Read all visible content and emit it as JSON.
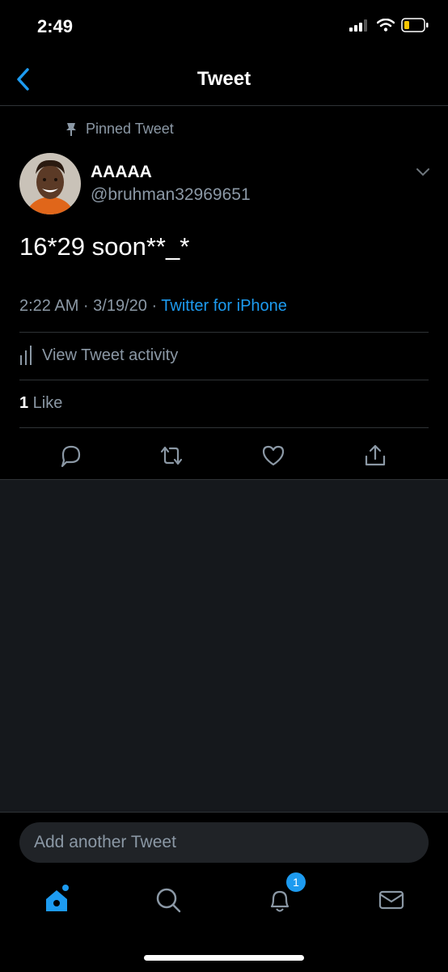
{
  "status_bar": {
    "time": "2:49"
  },
  "nav": {
    "title": "Tweet"
  },
  "tweet": {
    "pinned_label": "Pinned Tweet",
    "display_name": "AAAAA",
    "handle": "@bruhman32969651",
    "text": "16*29 soon**_*",
    "timestamp": "2:22 AM · 3/19/20 · ",
    "source": "Twitter for iPhone",
    "activity_label": "View Tweet activity",
    "like_count": "1",
    "like_label": " Like"
  },
  "compose": {
    "placeholder": "Add another Tweet"
  },
  "tabbar": {
    "notifications_badge": "1"
  },
  "colors": {
    "accent": "#1d9bf0",
    "background": "#000000",
    "secondary_text": "#8b98a5"
  }
}
